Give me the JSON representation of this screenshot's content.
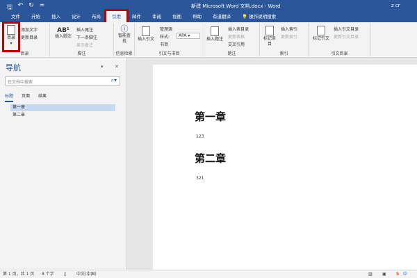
{
  "title": {
    "document": "新建 Microsoft Word 文档.docx - Word",
    "user": "z cr"
  },
  "tabs": [
    "文件",
    "开始",
    "插入",
    "设计",
    "布局",
    "引用",
    "邮件",
    "审阅",
    "视图",
    "帮助",
    "有道翻译"
  ],
  "tell_me": "操作说明搜索",
  "ribbon": {
    "toc": {
      "big": "目录",
      "add_text": "添加文字",
      "update": "更新目录",
      "label": "目录"
    },
    "footnotes": {
      "insert_footnote": "插入脚注",
      "insert_endnote": "插入尾注",
      "next_footnote": "下一条脚注",
      "show_notes": "显示备注",
      "label": "脚注"
    },
    "research": {
      "smart_lookup": "智能查找",
      "label": "信息检索"
    },
    "citations": {
      "insert_citation": "插入引文",
      "manage_sources": "管理源",
      "style_label": "样式:",
      "style_value": "APA",
      "bibliography": "书目",
      "label": "引文与书目"
    },
    "captions": {
      "insert_caption": "插入题注",
      "insert_tof": "插入表目录",
      "update_table": "更新表格",
      "cross_ref": "交叉引用",
      "label": "题注"
    },
    "index": {
      "mark_entry": "标记条目",
      "insert_index": "插入索引",
      "update_index": "更新索引",
      "label": "索引"
    },
    "toa": {
      "mark_citation": "标记引文",
      "insert_toa": "插入引文目录",
      "update_toa": "更新引文目录",
      "label": "引文目录"
    }
  },
  "nav": {
    "title": "导航",
    "search_placeholder": "在文档中搜索",
    "tabs": [
      "标题",
      "页面",
      "结果"
    ],
    "headings": [
      "第一章",
      "第二章"
    ]
  },
  "doc": {
    "h1": "第一章",
    "p1": "123",
    "h2": "第二章",
    "p2": "321"
  },
  "status": {
    "page": "第 1 页，共 1 页",
    "words": "8 个字",
    "lang": "中文(中国)"
  }
}
